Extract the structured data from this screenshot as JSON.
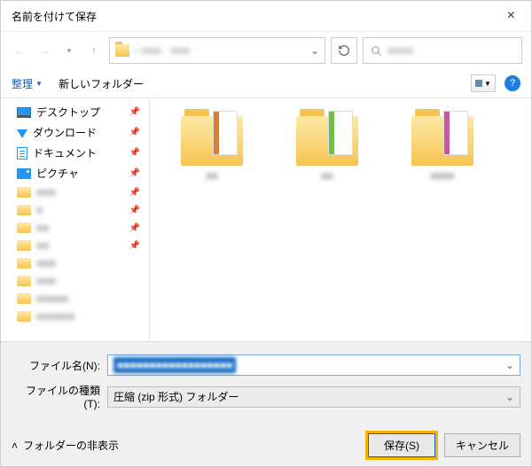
{
  "title": "名前を付けて保存",
  "nav": {
    "path_breadcrumb": "« ■■■ · ■■■ ·"
  },
  "search": {
    "placeholder": "■■■■"
  },
  "toolbar": {
    "organize": "整理",
    "new_folder": "新しいフォルダー"
  },
  "sidebar": {
    "items": [
      {
        "label": "デスクトップ",
        "icon": "desktop",
        "pinned": true
      },
      {
        "label": "ダウンロード",
        "icon": "download",
        "pinned": true
      },
      {
        "label": "ドキュメント",
        "icon": "document",
        "pinned": true
      },
      {
        "label": "ピクチャ",
        "icon": "pictures",
        "pinned": true
      },
      {
        "label": "■■■",
        "icon": "folder",
        "pinned": true,
        "blurred": true
      },
      {
        "label": "■",
        "icon": "folder",
        "pinned": true,
        "blurred": true
      },
      {
        "label": "■■",
        "icon": "folder",
        "pinned": true,
        "blurred": true
      },
      {
        "label": "■■",
        "icon": "folder",
        "pinned": true,
        "blurred": true
      },
      {
        "label": "■■■",
        "icon": "folder",
        "pinned": false,
        "blurred": true
      },
      {
        "label": "■■■",
        "icon": "folder",
        "pinned": false,
        "blurred": true
      },
      {
        "label": "■■■■■",
        "icon": "folder",
        "pinned": false,
        "blurred": true
      },
      {
        "label": "■■■■■■",
        "icon": "folder",
        "pinned": false,
        "blurred": true
      }
    ]
  },
  "content": {
    "folders": [
      {
        "label": "■■",
        "stripe": "#d97d3a"
      },
      {
        "label": "■■",
        "stripe": "#6fbf4a"
      },
      {
        "label": "■■■■",
        "stripe": "#c957a0"
      }
    ]
  },
  "fields": {
    "filename_label": "ファイル名(N):",
    "filename_value": "■■■■■■■■■■■■■■■■■■",
    "filetype_label": "ファイルの種類(T):",
    "filetype_value": "圧縮 (zip 形式) フォルダー"
  },
  "footer": {
    "hide_folders": "フォルダーの非表示",
    "save": "保存(S)",
    "cancel": "キャンセル"
  }
}
